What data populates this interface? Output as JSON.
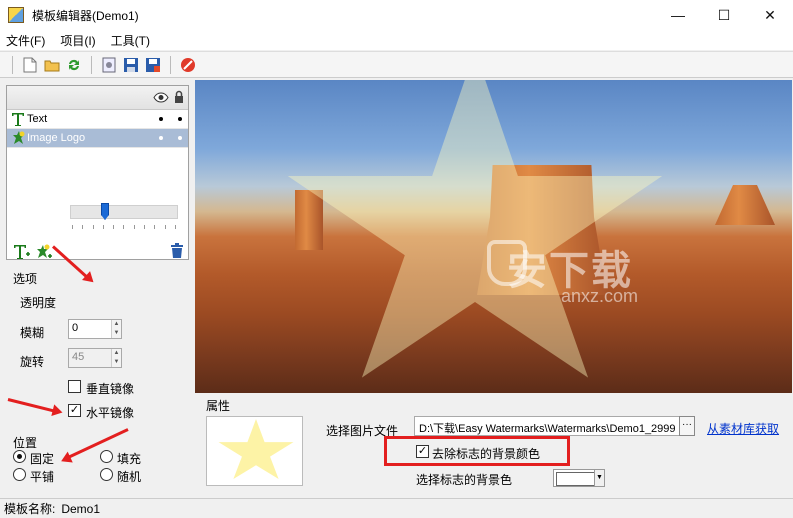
{
  "window": {
    "title": "模板编辑器(Demo1)",
    "minimize": "—",
    "maximize": "☐",
    "close": "✕"
  },
  "menu": [
    "文件(F)",
    "项目(I)",
    "工具(T)"
  ],
  "layers": {
    "items": [
      {
        "label": "Text"
      },
      {
        "label": "Image Logo"
      }
    ]
  },
  "options": {
    "group_label": "选项",
    "opacity_label": "透明度",
    "opacity_value": 0.3,
    "blur_label": "模糊",
    "blur_value": "0",
    "rotate_label": "旋转",
    "rotate_value": "45",
    "vertical_mirror_label": "垂直镜像",
    "vertical_mirror_checked": false,
    "horizontal_mirror_label": "水平镜像",
    "horizontal_mirror_checked": true
  },
  "position": {
    "group_label": "位置",
    "fixed": "固定",
    "fill": "填充",
    "tile": "平铺",
    "random": "随机",
    "selected": "固定"
  },
  "preview": {
    "watermark_text": "安下载",
    "watermark_sub": "anxz.com"
  },
  "properties": {
    "group_label": "属性",
    "choose_image_label": "选择图片文件",
    "image_path": "D:\\下载\\Easy Watermarks\\Watermarks\\Demo1_2999",
    "browse_label": "···",
    "library_link": "从素材库获取",
    "remove_bg_label": "去除标志的背景颜色",
    "remove_bg_checked": true,
    "bg_color_label": "选择标志的背景色",
    "bg_color": "#ffffff"
  },
  "status": {
    "template_name_label": "模板名称:",
    "template_name": "Demo1"
  },
  "colors": {
    "accent": "#1b6ad6",
    "highlight": "#e31f1f",
    "selection": "#a9bcd6",
    "link": "#0033cc"
  }
}
